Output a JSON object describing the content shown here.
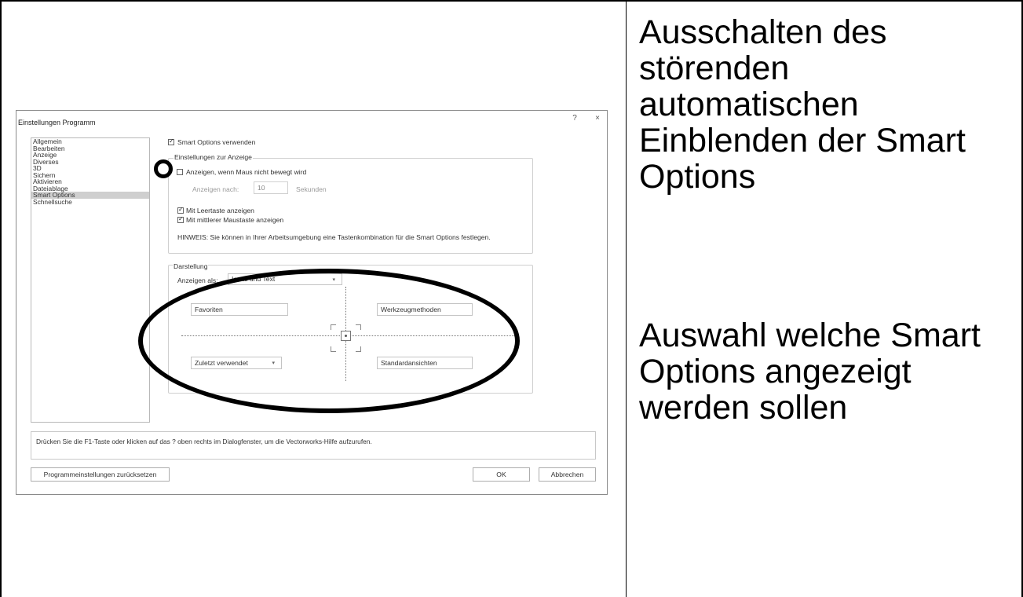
{
  "dialog": {
    "title": "Einstellungen Programm",
    "help_glyph": "?",
    "close_glyph": "×",
    "categories": [
      "Allgemein",
      "Bearbeiten",
      "Anzeige",
      "Diverses",
      "3D",
      "Sichern",
      "Aktivieren",
      "Dateiablage",
      "Smart Options",
      "Schnellsuche"
    ],
    "selected_category": "Smart Options",
    "use_smart_options": {
      "label": "Smart Options verwenden",
      "checked": true
    },
    "display_settings": {
      "title": "Einstellungen zur Anzeige",
      "show_when_idle": {
        "label": "Anzeigen, wenn Maus nicht bewegt wird",
        "checked": false
      },
      "delay_label": "Anzeigen nach:",
      "delay_value": "10",
      "delay_unit": "Sekunden",
      "space_key": {
        "label": "Mit Leertaste anzeigen",
        "checked": true
      },
      "middle_mouse": {
        "label": "Mit mittlerer Maustaste anzeigen",
        "checked": true
      },
      "hint": "HINWEIS: Sie können in Ihrer Arbeitsumgebung eine Tastenkombination für die Smart Options festlegen."
    },
    "presentation": {
      "title": "Darstellung",
      "show_as_label": "Anzeigen als:",
      "show_as_value": "Icons und Text",
      "quadrant_top_left": "Favoriten",
      "quadrant_top_right": "Werkzeugmethoden",
      "quadrant_bottom_left": "Zuletzt verwendet",
      "quadrant_bottom_right": "Standardansichten"
    },
    "info_text": "Drücken Sie die F1-Taste oder klicken auf das ? oben rechts im Dialogfenster, um die Vectorworks-Hilfe aufzurufen.",
    "reset_button": "Programmeinstellungen zurücksetzen",
    "ok_button": "OK",
    "cancel_button": "Abbrechen"
  },
  "notes": {
    "note_1": "Ausschalten des störenden automatischen Einblenden der Smart Options",
    "note_2": "Auswahl welche Smart Options angezeigt werden sollen"
  }
}
